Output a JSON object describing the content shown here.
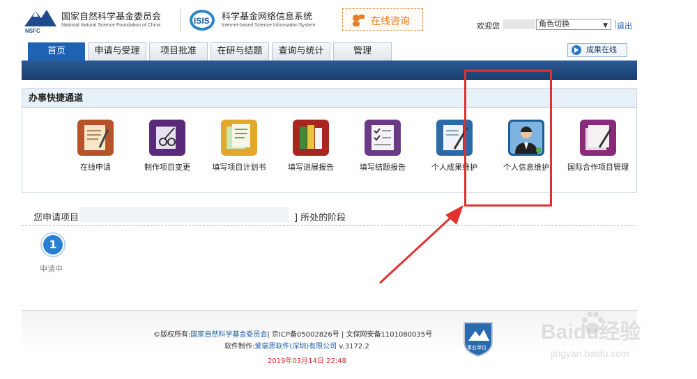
{
  "header": {
    "org_name": "国家自然科学基金委员会",
    "org_name_en": "National Natural Science Foundation of China",
    "org_abbr": "NSFC",
    "system_logo": "ISIS",
    "system_name": "科学基金网络信息系统",
    "system_name_en": "Internet-based Science Information System",
    "consult_label": "在线咨询",
    "welcome": "欢迎您",
    "role_select_value": "角色切换",
    "logout": "退出"
  },
  "nav": {
    "tabs": [
      {
        "label": "首页",
        "active": true
      },
      {
        "label": "申请与受理",
        "active": false
      },
      {
        "label": "项目批准",
        "active": false
      },
      {
        "label": "在研与结题",
        "active": false
      },
      {
        "label": "查询与统计",
        "active": false
      },
      {
        "label": "管理",
        "active": false
      }
    ],
    "achievement_button": "成果在线",
    "accent_color": "#1e62b4"
  },
  "shortcuts": {
    "title": "办事快捷通道",
    "items": [
      {
        "label": "在线申请",
        "icon": "notepad-icon"
      },
      {
        "label": "制作项目变更",
        "icon": "edit-cut-icon"
      },
      {
        "label": "填写项目计划书",
        "icon": "documents-icon"
      },
      {
        "label": "填写进展报告",
        "icon": "report-books-icon"
      },
      {
        "label": "填写结题报告",
        "icon": "checklist-icon"
      },
      {
        "label": "个人成果维护",
        "icon": "pen-document-icon"
      },
      {
        "label": "个人信息维护",
        "icon": "person-icon"
      },
      {
        "label": "国际合作项目管理",
        "icon": "folder-pen-icon"
      }
    ]
  },
  "project": {
    "prefix": "您申请项目",
    "suffix": "] 所处的阶段",
    "steps": [
      {
        "number": "1",
        "label": "申请中"
      }
    ]
  },
  "footer": {
    "copyright_prefix": "©版权所有:",
    "copyright_owner": "国家自然科学基金委员会",
    "icp": "| 京ICP备05002826号 | 文保网安备1101080035号",
    "software_prefix": "软件制作:",
    "software_vendor": "爱瑞思软件(深圳)有限公司",
    "version": "v.3172.2",
    "datetime": "2019年03月14日 22:48",
    "badge_label": "事业单位"
  },
  "watermark": {
    "brand": "Baidu经验",
    "url": "jingyan.baidu.com"
  }
}
